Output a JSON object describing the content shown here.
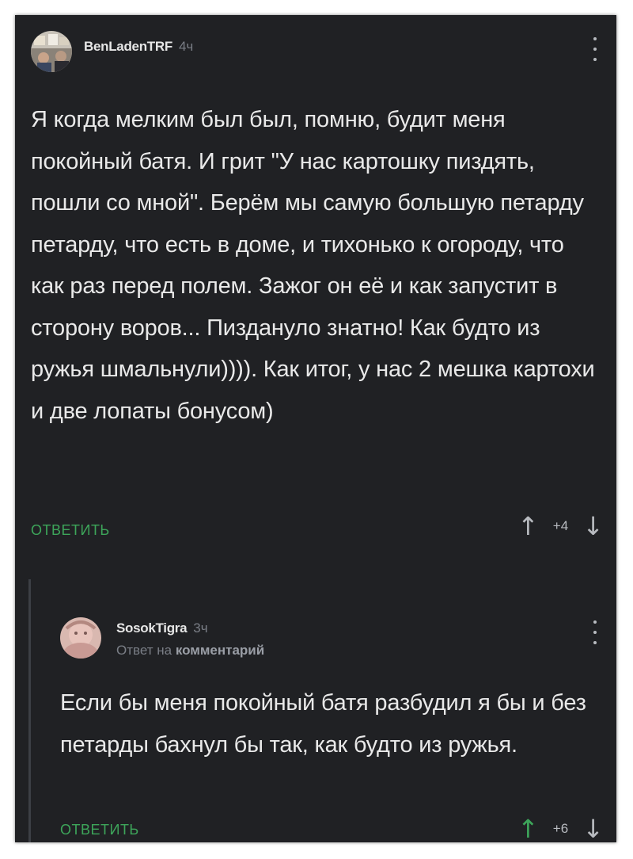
{
  "comments": [
    {
      "username": "BenLadenTRF",
      "time": "4ч",
      "text": "Я когда мелким был был, помню, будит меня покойный батя. И грит \"У нас картошку пиздять, пошли со мной\". Берём мы самую большую петарду петарду, что есть в доме, и тихонько к огороду, что как раз перед полем. Зажог он её и как запустит в сторону воров... Пиздануло знатно! Как будто из ружья шмальнули)))). Как итог, у нас 2 мешка картохи и две лопаты бонусом)",
      "reply_label": "ОТВЕТИТЬ",
      "score": "+4",
      "up_icon": "arrow-up-icon",
      "down_icon": "arrow-down-icon"
    },
    {
      "username": "SosokTigra",
      "time": "3ч",
      "reply_prefix": "Ответ на",
      "reply_target": "комментарий",
      "text": "Если бы меня покойный батя разбудил я бы и без петарды бахнул бы так, как будто из ружья.",
      "reply_label": "ОТВЕТИТЬ",
      "score": "+6",
      "up_icon": "arrow-up-icon",
      "down_icon": "arrow-down-icon"
    }
  ],
  "colors": {
    "background": "#202124",
    "accent": "#3da55a",
    "muted": "#7a7e86",
    "text": "#e9e9e9"
  }
}
